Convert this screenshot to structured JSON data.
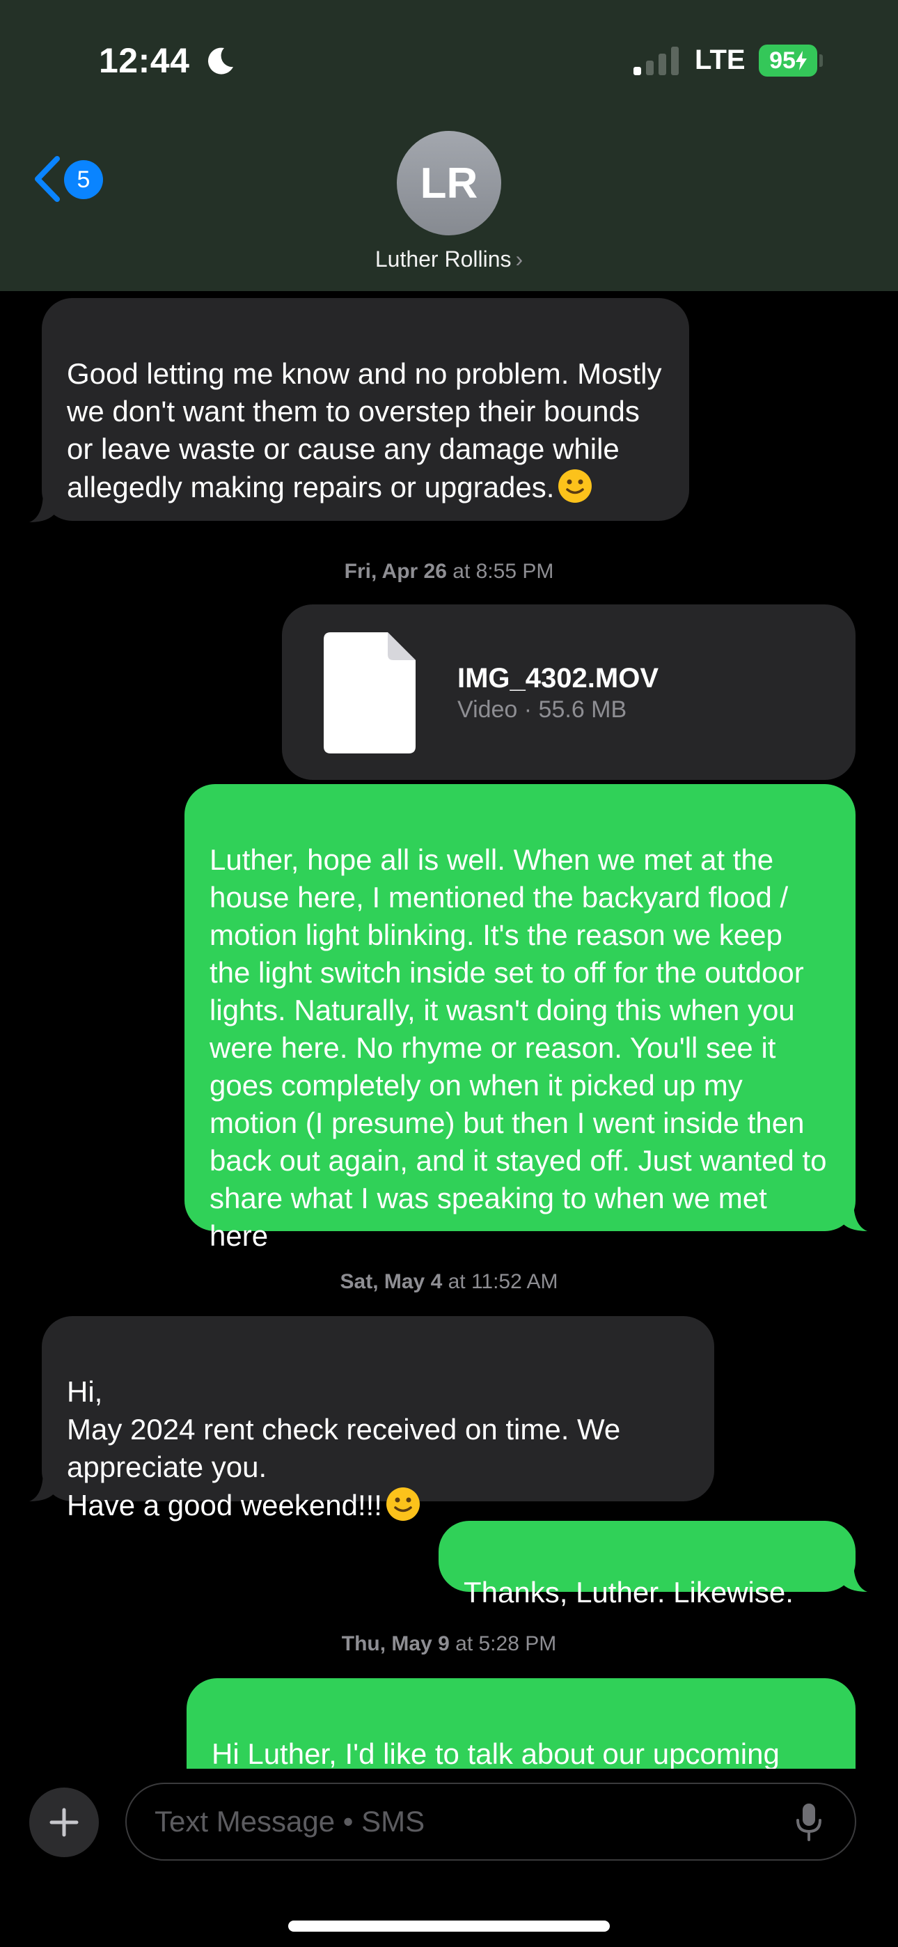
{
  "status_bar": {
    "time": "12:44",
    "network": "LTE",
    "battery": "95"
  },
  "header": {
    "back_badge": "5",
    "avatar_initials": "LR",
    "contact_name": "Luther Rollins"
  },
  "messages": {
    "m1": "Good letting me know and no problem. Mostly we don't want them to overstep their bounds or leave waste or cause any damage while allegedly making repairs or upgrades.",
    "ts1_day": "Fri, Apr 26",
    "ts1_time": "at 8:55 PM",
    "attachment": {
      "name": "IMG_4302.MOV",
      "meta": "Video · 55.6 MB"
    },
    "m2": "Luther, hope all is well. When we met at the house here, I mentioned the backyard flood / motion light blinking. It's the reason we keep the light switch inside set to off for the outdoor lights. Naturally, it wasn't doing this when you were here. No rhyme or reason. You'll see it goes completely on when it picked up my motion (I presume) but then I went inside then back out again, and it stayed off. Just wanted to share what I was speaking to when we met here",
    "ts2_day": "Sat, May 4",
    "ts2_time": "at 11:52 AM",
    "m3": "Hi,\nMay 2024 rent check received on time. We appreciate you.\nHave a good weekend!!!",
    "m4": "Thanks, Luther. Likewise.",
    "ts3_day": "Thu, May 9",
    "ts3_time": "at 5:28 PM",
    "m5": "Hi Luther, I'd like to talk about our upcoming lease renewal. We discussed it"
  },
  "composer": {
    "placeholder": "Text Message • SMS"
  },
  "colors": {
    "header_bg": "#243127",
    "incoming": "#262628",
    "outgoing": "#30d158",
    "accent": "#0a84ff"
  }
}
